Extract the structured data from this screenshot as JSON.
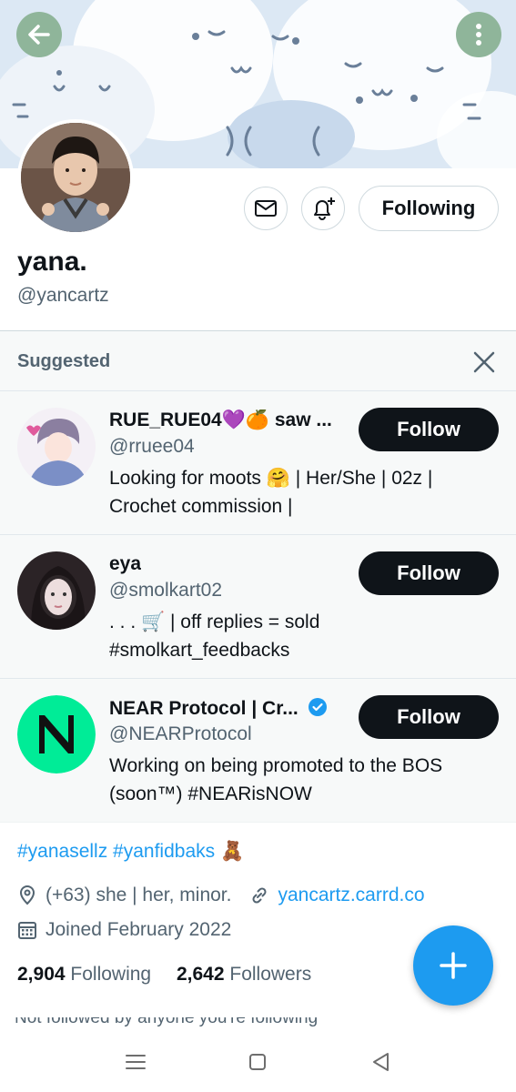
{
  "profile": {
    "display_name": "yana.",
    "handle": "@yancartz",
    "following_label": "Following"
  },
  "icons": {
    "back": "back-arrow-icon",
    "more": "more-vertical-icon",
    "message": "mail-icon",
    "notify": "bell-plus-icon",
    "close": "close-icon",
    "location": "location-pin-icon",
    "link": "link-icon",
    "calendar": "calendar-icon",
    "compose": "plus-icon"
  },
  "suggested": {
    "title": "Suggested",
    "items": [
      {
        "name": "RUE_RUE04💜🍊 saw ...",
        "handle": "@rruee04",
        "bio_line1": "Looking for moots 🤗 | Her/She | 02z |",
        "bio_line2": "Crochet commission |",
        "button": "Follow"
      },
      {
        "name": "eya",
        "handle": "@smolkart02",
        "bio_line1": ". . . 🛒 | off replies = sold",
        "bio_line2": "#smolkart_feedbacks",
        "button": "Follow"
      },
      {
        "name": "NEAR Protocol | Cr...",
        "handle": "@NEARProtocol",
        "bio_line1": "Working on being promoted to the BOS",
        "bio_line2": "(soon™)  #NEARisNOW",
        "button": "Follow"
      }
    ]
  },
  "bio": {
    "tags": "#yanasellz #yanfidbaks 🧸",
    "location": "(+63) she | her, minor.",
    "website": "yancartz.carrd.co",
    "joined": "Joined February 2022",
    "following_count": "2,904",
    "following_label": "Following",
    "followers_count": "2,642",
    "followers_label": "Followers",
    "cut_text": "Not followed by anyone you're following"
  },
  "colors": {
    "accent": "#1d9bf0",
    "near_green": "#00ec97",
    "banner_button": "#8fb59a",
    "follow_button": "#0f1419"
  }
}
